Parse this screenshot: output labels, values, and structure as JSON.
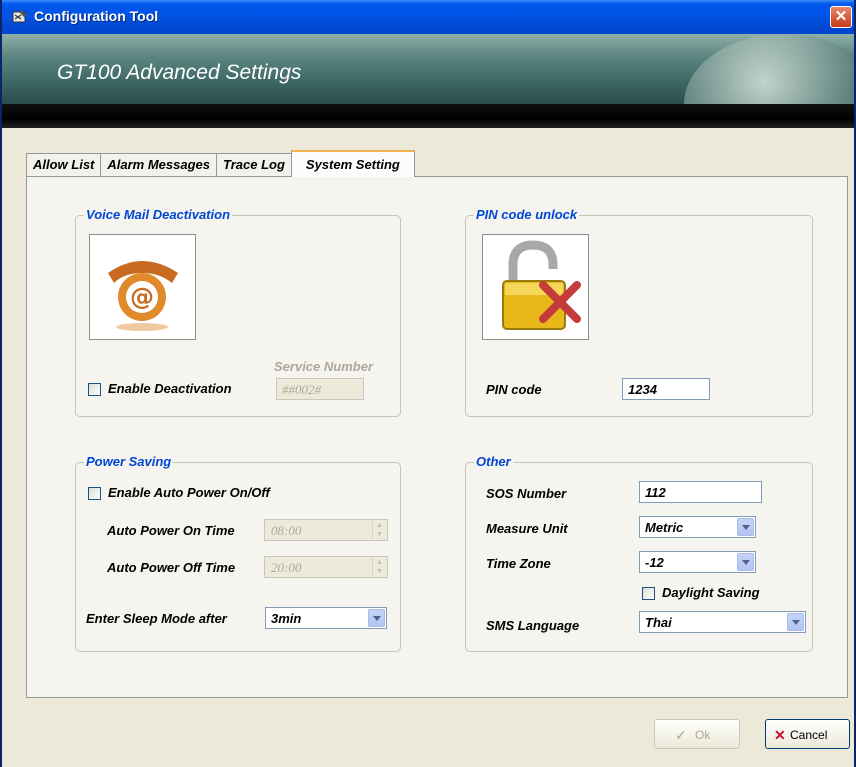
{
  "window": {
    "title": "Configuration Tool",
    "close_glyph": "✕"
  },
  "banner": {
    "title": "GT100 Advanced Settings"
  },
  "tabs": [
    "Allow List",
    "Alarm Messages",
    "Trace Log",
    "System Setting"
  ],
  "voice_mail": {
    "legend": "Voice Mail Deactivation",
    "service_number_label": "Service Number",
    "enable_label": "Enable Deactivation",
    "service_number_value": "##002#"
  },
  "pin": {
    "legend": "PIN code unlock",
    "label": "PIN code",
    "value": "1234"
  },
  "power": {
    "legend": "Power Saving",
    "enable_label": "Enable Auto Power On/Off",
    "on_label": "Auto Power On Time",
    "on_value": "08:00",
    "off_label": "Auto Power Off Time",
    "off_value": "20:00",
    "sleep_label": "Enter Sleep Mode after",
    "sleep_value": "3min"
  },
  "other": {
    "legend": "Other",
    "sos_label": "SOS Number",
    "sos_value": "112",
    "measure_label": "Measure Unit",
    "measure_value": "Metric",
    "timezone_label": "Time Zone",
    "timezone_value": "-12",
    "daylight_label": "Daylight Saving",
    "sms_label": "SMS Language",
    "sms_value": "Thai"
  },
  "buttons": {
    "ok": "Ok",
    "ok_glyph": "✓",
    "cancel": "Cancel",
    "cancel_glyph": "✕"
  },
  "colors": {
    "legend": "#0046d5",
    "titlebar": "#0153e4",
    "cancel_x": "#c8102e"
  }
}
